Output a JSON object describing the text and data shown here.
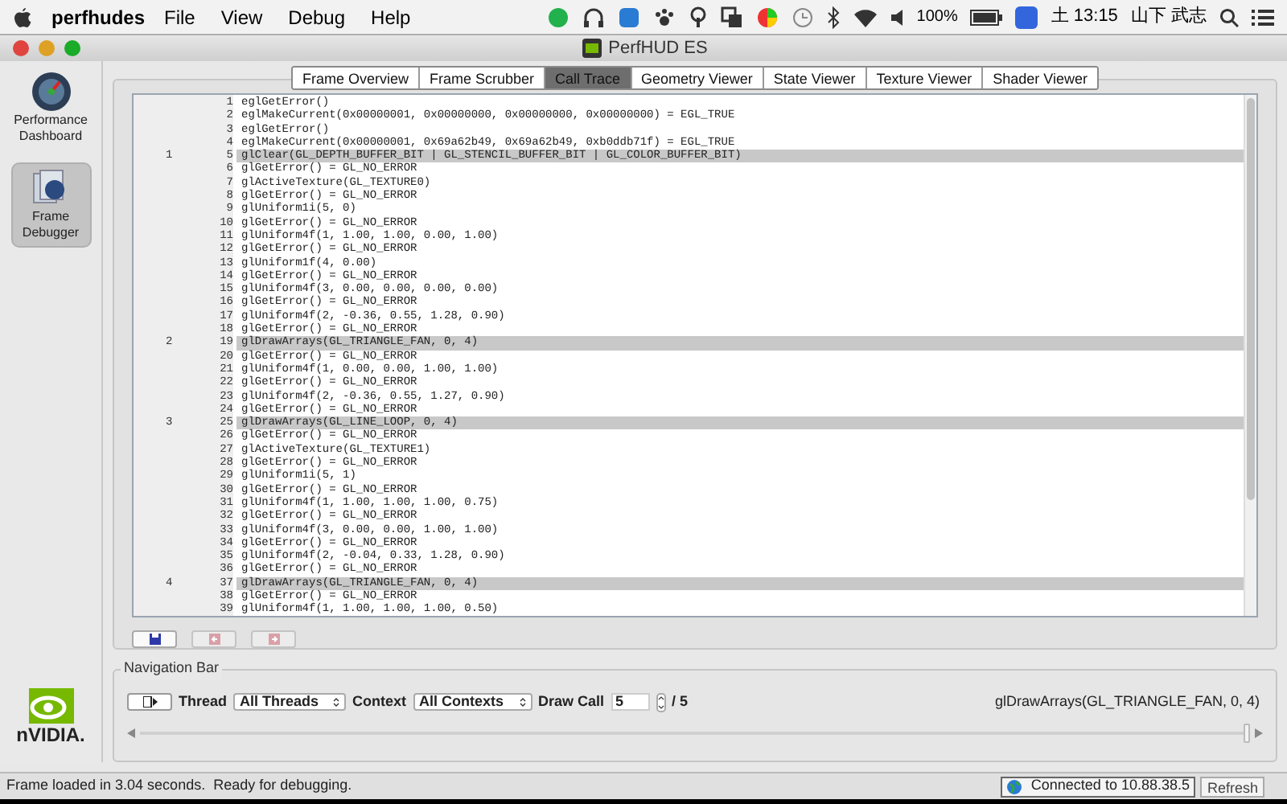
{
  "menu_bar": {
    "app": "perfhudes",
    "menus": [
      "File",
      "View",
      "Debug",
      "Help"
    ],
    "battery": "100%",
    "clock": "土 13:15",
    "user": "山下 武志"
  },
  "window": {
    "title": "PerfHUD ES"
  },
  "sidebar": {
    "logo": "nVIDIA.",
    "items": [
      {
        "label": "Performance Dashboard",
        "selected": false
      },
      {
        "label": "Frame Debugger",
        "selected": true
      }
    ]
  },
  "tabs": [
    {
      "label": "Frame Overview",
      "selected": false
    },
    {
      "label": "Frame Scrubber",
      "selected": false
    },
    {
      "label": "Call Trace",
      "selected": true
    },
    {
      "label": "Geometry Viewer",
      "selected": false
    },
    {
      "label": "State Viewer",
      "selected": false
    },
    {
      "label": "Texture Viewer",
      "selected": false
    },
    {
      "label": "Shader Viewer",
      "selected": false
    }
  ],
  "call_trace": [
    {
      "line": "1",
      "code": "eglGetError()",
      "selected": false
    },
    {
      "line": "2",
      "code": "eglMakeCurrent(0x00000001, 0x00000000, 0x00000000, 0x00000000) = EGL_TRUE",
      "selected": false
    },
    {
      "line": "3",
      "code": "eglGetError()",
      "selected": false
    },
    {
      "line": "4",
      "code": "eglMakeCurrent(0x00000001, 0x69a62b49, 0x69a62b49, 0xb0ddb71f) = EGL_TRUE",
      "selected": false
    },
    {
      "draw_call": "1",
      "line": "5",
      "code": "glClear(GL_DEPTH_BUFFER_BIT | GL_STENCIL_BUFFER_BIT | GL_COLOR_BUFFER_BIT)",
      "selected": true
    },
    {
      "line": "6",
      "code": "glGetError() = GL_NO_ERROR",
      "selected": false
    },
    {
      "line": "7",
      "code": "glActiveTexture(GL_TEXTURE0)",
      "selected": false
    },
    {
      "line": "8",
      "code": "glGetError() = GL_NO_ERROR",
      "selected": false
    },
    {
      "line": "9",
      "code": "glUniform1i(5, 0)",
      "selected": false
    },
    {
      "line": "10",
      "code": "glGetError() = GL_NO_ERROR",
      "selected": false
    },
    {
      "line": "11",
      "code": "glUniform4f(1, 1.00, 1.00, 0.00, 1.00)",
      "selected": false
    },
    {
      "line": "12",
      "code": "glGetError() = GL_NO_ERROR",
      "selected": false
    },
    {
      "line": "13",
      "code": "glUniform1f(4, 0.00)",
      "selected": false
    },
    {
      "line": "14",
      "code": "glGetError() = GL_NO_ERROR",
      "selected": false
    },
    {
      "line": "15",
      "code": "glUniform4f(3, 0.00, 0.00, 0.00, 0.00)",
      "selected": false
    },
    {
      "line": "16",
      "code": "glGetError() = GL_NO_ERROR",
      "selected": false
    },
    {
      "line": "17",
      "code": "glUniform4f(2, -0.36, 0.55, 1.28, 0.90)",
      "selected": false
    },
    {
      "line": "18",
      "code": "glGetError() = GL_NO_ERROR",
      "selected": false
    },
    {
      "draw_call": "2",
      "line": "19",
      "code": "glDrawArrays(GL_TRIANGLE_FAN, 0, 4)",
      "selected": true
    },
    {
      "line": "20",
      "code": "glGetError() = GL_NO_ERROR",
      "selected": false
    },
    {
      "line": "21",
      "code": "glUniform4f(1, 0.00, 0.00, 1.00, 1.00)",
      "selected": false
    },
    {
      "line": "22",
      "code": "glGetError() = GL_NO_ERROR",
      "selected": false
    },
    {
      "line": "23",
      "code": "glUniform4f(2, -0.36, 0.55, 1.27, 0.90)",
      "selected": false
    },
    {
      "line": "24",
      "code": "glGetError() = GL_NO_ERROR",
      "selected": false
    },
    {
      "draw_call": "3",
      "line": "25",
      "code": "glDrawArrays(GL_LINE_LOOP, 0, 4)",
      "selected": true
    },
    {
      "line": "26",
      "code": "glGetError() = GL_NO_ERROR",
      "selected": false
    },
    {
      "line": "27",
      "code": "glActiveTexture(GL_TEXTURE1)",
      "selected": false
    },
    {
      "line": "28",
      "code": "glGetError() = GL_NO_ERROR",
      "selected": false
    },
    {
      "line": "29",
      "code": "glUniform1i(5, 1)",
      "selected": false
    },
    {
      "line": "30",
      "code": "glGetError() = GL_NO_ERROR",
      "selected": false
    },
    {
      "line": "31",
      "code": "glUniform4f(1, 1.00, 1.00, 1.00, 0.75)",
      "selected": false
    },
    {
      "line": "32",
      "code": "glGetError() = GL_NO_ERROR",
      "selected": false
    },
    {
      "line": "33",
      "code": "glUniform4f(3, 0.00, 0.00, 1.00, 1.00)",
      "selected": false
    },
    {
      "line": "34",
      "code": "glGetError() = GL_NO_ERROR",
      "selected": false
    },
    {
      "line": "35",
      "code": "glUniform4f(2, -0.04, 0.33, 1.28, 0.90)",
      "selected": false
    },
    {
      "line": "36",
      "code": "glGetError() = GL_NO_ERROR",
      "selected": false
    },
    {
      "draw_call": "4",
      "line": "37",
      "code": "glDrawArrays(GL_TRIANGLE_FAN, 0, 4)",
      "selected": true
    },
    {
      "line": "38",
      "code": "glGetError() = GL_NO_ERROR",
      "selected": false
    },
    {
      "line": "39",
      "code": "glUniform4f(1, 1.00, 1.00, 1.00, 0.50)",
      "selected": false
    }
  ],
  "navigation_bar": {
    "title": "Navigation Bar",
    "thread_label": "Thread",
    "thread": "All Threads",
    "context_label": "Context",
    "context": "All Contexts",
    "draw_call_label": "Draw Call",
    "draw_call": "5",
    "draw_call_total": "/ 5",
    "current_call": "glDrawArrays(GL_TRIANGLE_FAN, 0, 4)",
    "scrubber": {
      "level": 1
    }
  },
  "status_bar": {
    "message": "Frame loaded in 3.04 seconds.  Ready for debugging.",
    "connection": "Connected to 10.88.38.5",
    "refresh": "Refresh"
  }
}
